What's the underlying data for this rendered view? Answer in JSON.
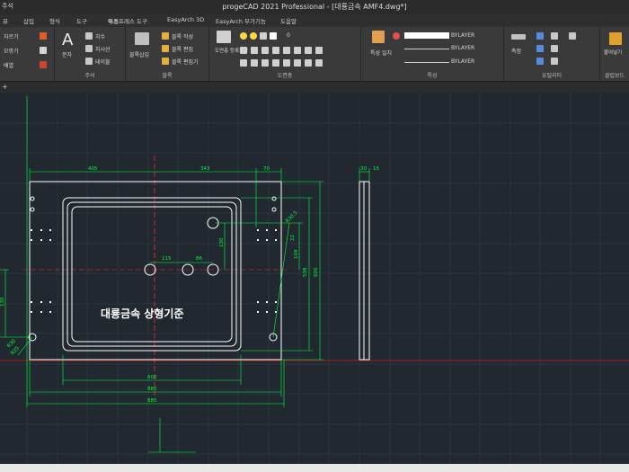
{
  "title": "progeCAD 2021 Professional - [대룡금속 AMF4.dwg*]",
  "menu": [
    "파일",
    "편집",
    "뷰",
    "삽입",
    "형식",
    "도구",
    "그리기",
    "치수",
    "수정",
    "익스프레스 도구",
    "EasyArch 3D",
    "EasyArch 부가기능",
    "도움말"
  ],
  "menu_visible": [
    "뷰",
    "삽입",
    "형식",
    "도구",
    "수정",
    "익스프레스 도구",
    "EasyArch 3D",
    "EasyArch 부가기능",
    "도움말"
  ],
  "quick_access_label": "주석",
  "ribbon": {
    "panel1": {
      "items": [
        "자르기",
        "모깎기",
        "배열"
      ]
    },
    "annotation": {
      "label": "주석",
      "text_button": "문자",
      "items": [
        "치수",
        "지시선",
        "테이블"
      ]
    },
    "block": {
      "label": "블록",
      "insert": "블록삽입",
      "items": [
        "블록 작성",
        "블록 편집",
        "블록 편집기"
      ]
    },
    "layer": {
      "label": "도면층",
      "props": "도면층 등록정보",
      "current": "0"
    },
    "properties": {
      "label": "특성",
      "match": "특성 일치",
      "color": "BYLAYER",
      "linetype": "BYLAYER",
      "lineweight": "BYLAYER"
    },
    "utility": {
      "label": "유틸리티",
      "measure": "측정",
      "paste": "붙여넣기",
      "clip": "클립보드"
    },
    "clipboard": {
      "label": "클립보드",
      "paste": "붙여넣기"
    }
  },
  "drawing": {
    "note_text": "대룡금속 상형기준",
    "dims_top": [
      "405",
      "343",
      "70"
    ],
    "dims_side": [
      "30",
      "15"
    ],
    "dims_bottom": [
      "600",
      "880",
      "880"
    ],
    "dims_right": [
      "130",
      "104",
      "R30.5",
      "600",
      "538",
      "R25.5",
      "22"
    ],
    "dims_inner": [
      "115",
      "86"
    ],
    "dims_left": [
      "R30",
      "R25",
      "130"
    ]
  },
  "colors": {
    "bg": "#212830",
    "green": "#00ff3c",
    "red": "#ff2a2a",
    "white": "#ffffff",
    "grid": "#2d3640"
  }
}
